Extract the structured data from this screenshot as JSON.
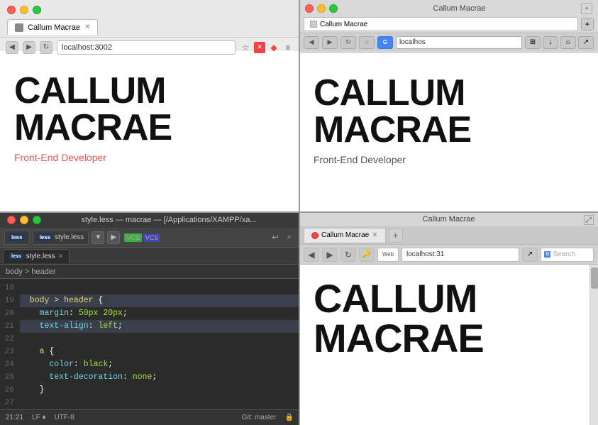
{
  "topLeft": {
    "tab": {
      "title": "Callum Macrae"
    },
    "addressBar": {
      "url": "localhost:3002"
    },
    "content": {
      "titleLine1": "CALLUM",
      "titleLine2": "MACRAE",
      "subtitle": "Front-End Developer"
    }
  },
  "topRight": {
    "windowTitle": "Callum Macrae",
    "tab": {
      "title": "Callum Macrae"
    },
    "addressBar": {
      "url": "localhos"
    },
    "content": {
      "titleLine1": "CALLUM",
      "titleLine2": "MACRAE",
      "subtitle": "Front-End Developer"
    }
  },
  "bottomLeft": {
    "titlebar": "style.less — macrae — [/Applications/XAMPP/xa...",
    "tabs": [
      {
        "label": "less"
      },
      {
        "label": "style.less"
      }
    ],
    "activeTab": "style.less",
    "breadcrumb": "body > header",
    "lines": [
      {
        "num": "18",
        "content": ""
      },
      {
        "num": "19",
        "content": "  body > header {",
        "highlighted": true
      },
      {
        "num": "20",
        "content": "    margin: 50px 20px;"
      },
      {
        "num": "21",
        "content": "    text-align: left;",
        "highlighted": true
      },
      {
        "num": "22",
        "content": ""
      },
      {
        "num": "23",
        "content": "    a {"
      },
      {
        "num": "24",
        "content": "      color: black;"
      },
      {
        "num": "25",
        "content": "      text-decoration: none;"
      },
      {
        "num": "26",
        "content": "    }"
      },
      {
        "num": "27",
        "content": ""
      }
    ],
    "statusBar": {
      "position": "21:21",
      "encoding": "LF",
      "charset": "UTF-8",
      "vcs": "Git: master"
    }
  },
  "bottomRight": {
    "windowTitle": "Callum Macrae",
    "tab": {
      "title": "Callum Macrae"
    },
    "addressBar": {
      "url": "localhost:31"
    },
    "searchBox": "Search",
    "content": {
      "titleLine1": "CALLUM",
      "titleLine2": "MACRAE"
    }
  }
}
